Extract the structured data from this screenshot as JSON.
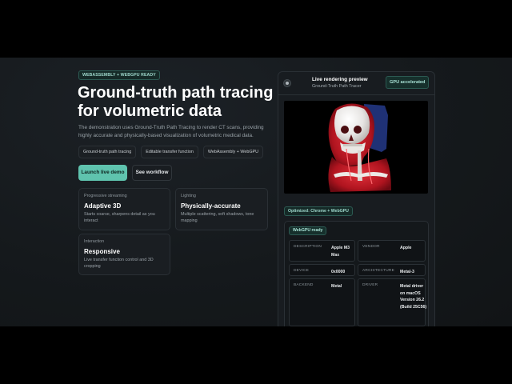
{
  "hero": {
    "badge": "WEBASSEMBLY + WEBGPU READY",
    "title_line1": "Ground-truth path tracing",
    "title_line2": "for volumetric data",
    "description": "The demonstration uses Ground-Truth Path Tracing to render CT scans, providing highly accurate and physically-based visualization of volumetric medical data.",
    "chips": [
      "Ground-truth path tracing",
      "Editable transfer function",
      "WebAssembly + WebGPU"
    ],
    "launch_label": "Launch live demo",
    "workflow_label": "See workflow"
  },
  "features": [
    {
      "kicker": "Progressive streaming",
      "title": "Adaptive 3D",
      "desc": "Starts coarse, sharpens detail as you interact"
    },
    {
      "kicker": "Lighting",
      "title": "Physically-accurate",
      "desc": "Multiple scattering, soft shadows, tone mapping"
    },
    {
      "kicker": "Interaction",
      "title": "Responsive",
      "desc": "Live transfer function control and 3D cropping"
    }
  ],
  "preview": {
    "title": "Live rendering preview",
    "subtitle": "Ground-Truth Path Tracer",
    "gpu_badge": "GPU accelerated",
    "optimized_badge": "Optimized: Chrome + WebGPU",
    "ready_badge": "WebGPU ready",
    "info": [
      {
        "key": "DESCRIPTION",
        "value": "Apple M3 Max"
      },
      {
        "key": "VENDOR",
        "value": "Apple"
      },
      {
        "key": "DEVICE",
        "value": "0x0000"
      },
      {
        "key": "ARCHITECTURE",
        "value": "Metal-3"
      },
      {
        "key": "BACKEND",
        "value": "Metal"
      },
      {
        "key": "DRIVER",
        "value": "Metal driver on macOS Version 26.2 (Build 25C56)"
      }
    ]
  },
  "colors": {
    "accent": "#5fc3ae",
    "background": "#15191c",
    "letterbox": "#000000"
  }
}
